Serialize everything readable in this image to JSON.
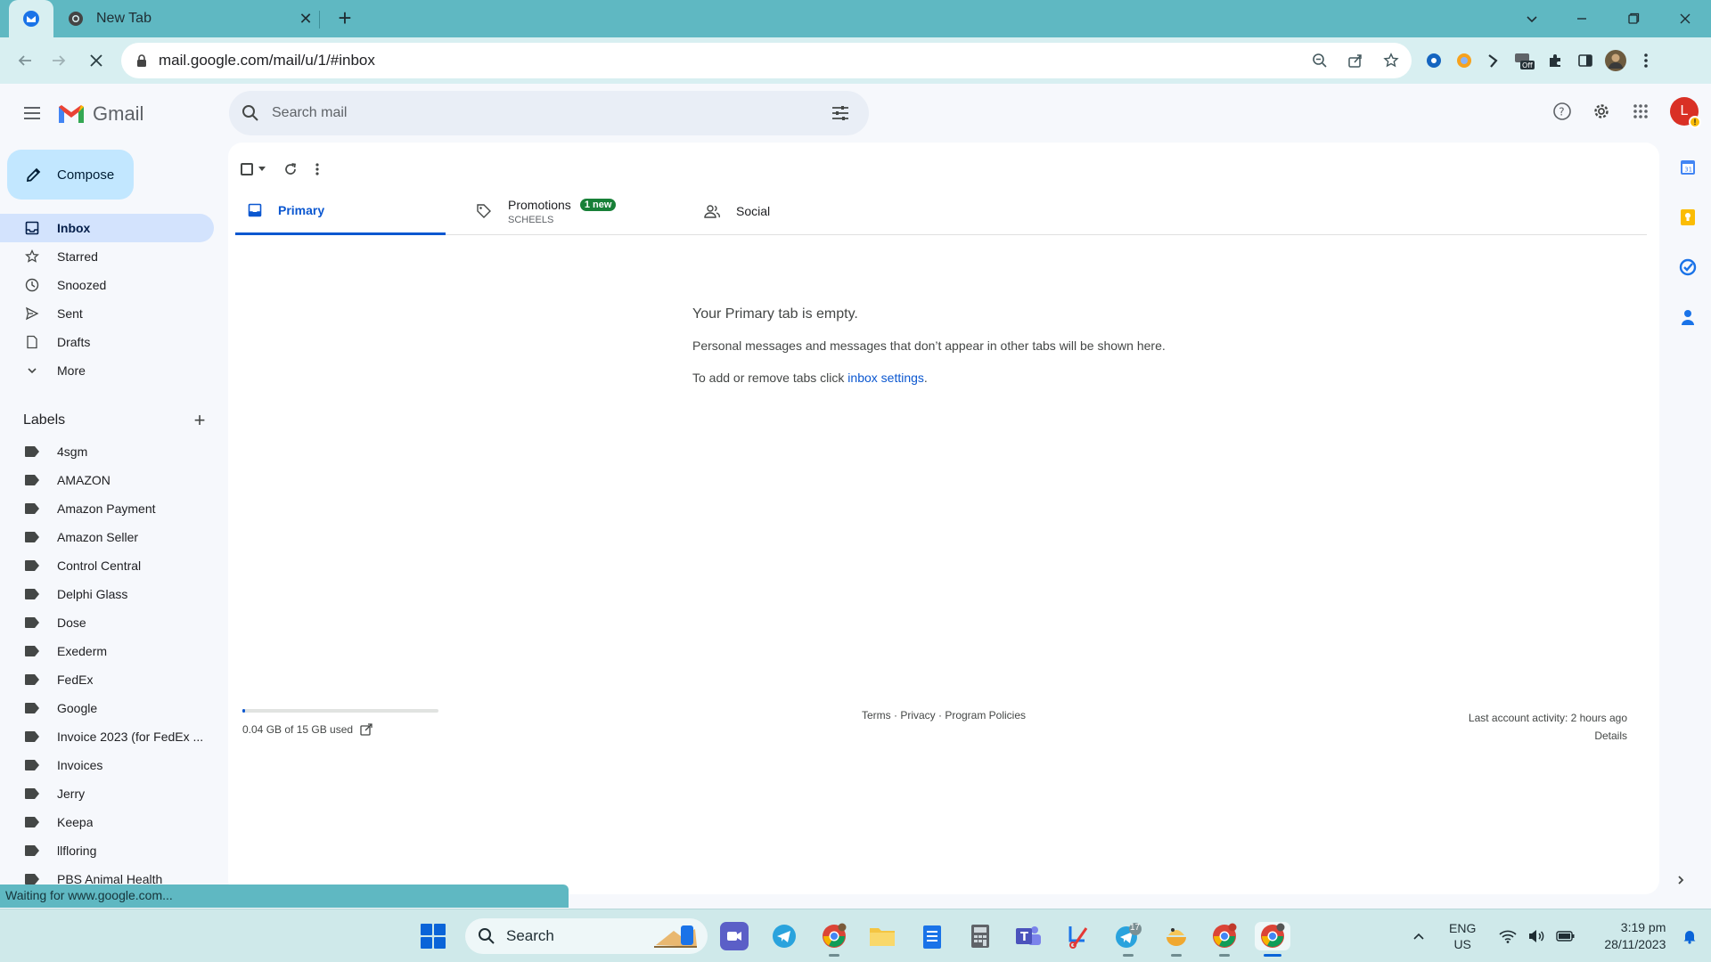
{
  "browser": {
    "tab_title": "New Tab",
    "url": "mail.google.com/mail/u/1/#inbox",
    "status_text": "Waiting for www.google.com..."
  },
  "gmail": {
    "app_name": "Gmail",
    "search_placeholder": "Search mail",
    "avatar_letter": "L",
    "compose_label": "Compose",
    "nav": [
      {
        "label": "Inbox",
        "icon": "inbox-icon"
      },
      {
        "label": "Starred",
        "icon": "star-icon"
      },
      {
        "label": "Snoozed",
        "icon": "clock-icon"
      },
      {
        "label": "Sent",
        "icon": "send-icon"
      },
      {
        "label": "Drafts",
        "icon": "draft-icon"
      },
      {
        "label": "More",
        "icon": "chevron-down-icon"
      }
    ],
    "labels_heading": "Labels",
    "labels": [
      "4sgm",
      "AMAZON",
      "Amazon Payment",
      "Amazon Seller",
      "Control Central",
      "Delphi Glass",
      "Dose",
      "Exederm",
      "FedEx",
      "Google",
      "Invoice 2023 (for FedEx ...",
      "Invoices",
      "Jerry",
      "Keepa",
      "llfloring",
      "PBS Animal Health"
    ],
    "tabs": {
      "primary": "Primary",
      "promotions": "Promotions",
      "promotions_badge": "1 new",
      "promotions_sender": "SCHEELS",
      "social": "Social"
    },
    "empty_state": {
      "heading": "Your Primary tab is empty.",
      "line1": "Personal messages and messages that don’t appear in other tabs will be shown here.",
      "line2_prefix": "To add or remove tabs click ",
      "line2_link": "inbox settings",
      "line2_suffix": "."
    },
    "footer": {
      "storage_text": "0.04 GB of 15 GB used",
      "storage_fraction": 0.003,
      "links": "Terms · Privacy · Program Policies",
      "activity": "Last account activity: 2 hours ago",
      "details": "Details"
    }
  },
  "taskbar": {
    "search_placeholder": "Search",
    "telegram_badge": "17",
    "lang_1": "ENG",
    "lang_2": "US",
    "time": "3:19 pm",
    "date": "28/11/2023"
  },
  "colors": {
    "chrome_frame": "#5fb8c2",
    "toolbar": "#d8eff1",
    "gmail_bg": "#f6f8fc",
    "compose": "#c2e7ff",
    "active_nav": "#d3e3fd",
    "primary_blue": "#0b57d0",
    "badge_green": "#188038",
    "gmail_red": "#ea4335"
  }
}
